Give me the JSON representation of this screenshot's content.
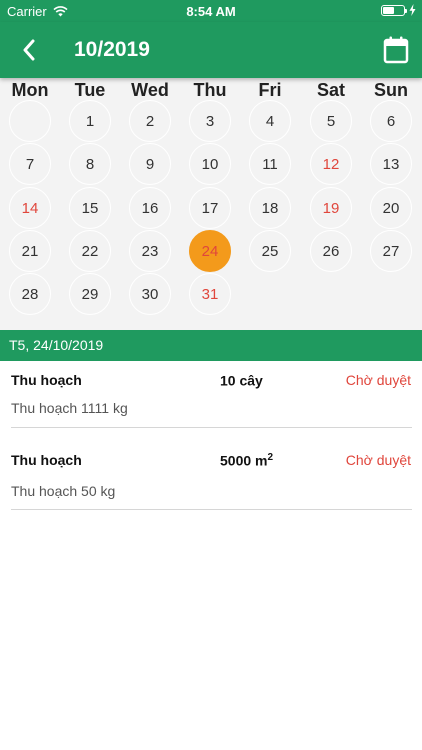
{
  "status_bar": {
    "carrier": "Carrier",
    "time": "8:54 AM",
    "battery_level": 0.55
  },
  "header": {
    "title": "10/2019",
    "back_icon": "chevron-left-icon",
    "calendar_icon": "calendar-icon"
  },
  "calendar": {
    "weekdays": [
      "Mon",
      "Tue",
      "Wed",
      "Thu",
      "Fri",
      "Sat",
      "Sun"
    ],
    "empty_cell": "",
    "days": [
      "1",
      "2",
      "3",
      "4",
      "5",
      "6",
      "7",
      "8",
      "9",
      "10",
      "11",
      "12",
      "13",
      "14",
      "15",
      "16",
      "17",
      "18",
      "19",
      "20",
      "21",
      "22",
      "23",
      "24",
      "25",
      "26",
      "27",
      "28",
      "29",
      "30",
      "31"
    ],
    "selected_day": "24",
    "highlighted_days": [
      "12",
      "14",
      "19",
      "24",
      "31"
    ]
  },
  "selected_date_label": "T5, 24/10/2019",
  "entries": [
    {
      "title": "Thu hoạch",
      "quantity": "10 cây",
      "quantity_sup": "",
      "status": "Chờ duyệt",
      "description": "Thu hoạch 1111 kg"
    },
    {
      "title": "Thu hoạch",
      "quantity": "5000 m",
      "quantity_sup": "2",
      "status": "Chờ duyệt",
      "description": "Thu hoạch 50 kg"
    }
  ],
  "colors": {
    "primary": "#1f9a5f",
    "selected": "#f39a1b",
    "status_text": "#e0463c"
  }
}
